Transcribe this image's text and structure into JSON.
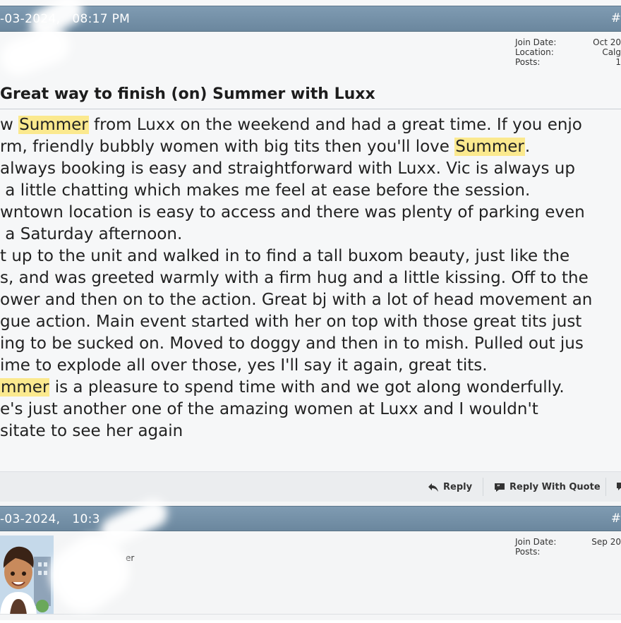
{
  "post1": {
    "date": "-03-2024,   08:17 PM",
    "number_glyph": "#",
    "userinfo": [
      {
        "label": "Join Date:",
        "value": "Oct 20"
      },
      {
        "label": "Location:",
        "value": "Calg"
      },
      {
        "label": "Posts:",
        "value": "1"
      }
    ],
    "title": "Great way to finish (on) Summer with Luxx",
    "lines": [
      [
        "w ",
        {
          "hl": "Summer"
        },
        " from Luxx on the weekend and had a great time. If you enjo"
      ],
      [
        "rm, friendly bubbly women with big tits then you'll love ",
        {
          "hl": "Summer"
        },
        "."
      ],
      [
        "always booking is easy and straightforward with Luxx. Vic is always up"
      ],
      [
        " a little chatting which makes me feel at ease before the session."
      ],
      [
        "wntown location is easy to access and there was plenty of parking even"
      ],
      [
        " a Saturday afternoon."
      ],
      [
        "t up to the unit and walked in to find a tall buxom beauty, just like the"
      ],
      [
        "s, and was greeted warmly with a firm hug and a little kissing. Off to the"
      ],
      [
        "ower and then on to the action. Great bj with a lot of head movement an"
      ],
      [
        "gue action. Main event started with her on top with those great tits just"
      ],
      [
        "ing to be sucked on. Moved to doggy and then in to mish. Pulled out jus"
      ],
      [
        "ime to explode all over those, yes I'll say it again, great tits."
      ],
      [
        {
          "hl": "mmer"
        },
        " is a pleasure to spend time with and we got along wonderfully."
      ],
      [
        "e's just another one of the amazing women at Luxx and I wouldn't"
      ],
      [
        "sitate to see her again"
      ]
    ],
    "actions": {
      "reply": "Reply",
      "reply_with_quote": "Reply With Quote"
    }
  },
  "post2": {
    "date": "-03-2024,   10:3",
    "number_glyph": "#",
    "user_title": "er",
    "userinfo": [
      {
        "label": "Join Date:",
        "value": "Sep 20"
      },
      {
        "label": "Posts:",
        "value": ""
      }
    ]
  },
  "colors": {
    "header": "#7390a7",
    "highlight": "#fbe98e",
    "post_bg": "#f6f7f8"
  }
}
